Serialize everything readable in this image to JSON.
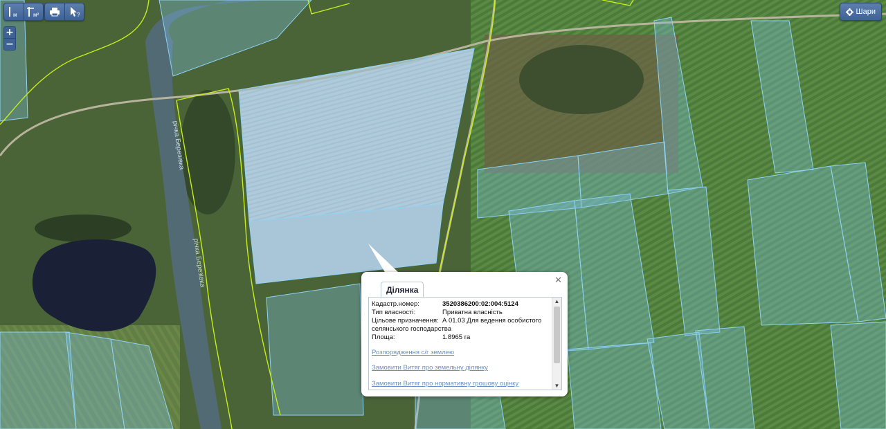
{
  "toolbar": {
    "measure_line_label": "м",
    "measure_area_label": "м²",
    "print_icon": "print-icon",
    "identify_icon": "cursor-question-icon"
  },
  "zoom": {
    "in_label": "+",
    "out_label": "−"
  },
  "layers": {
    "label": "Шари",
    "icon": "gear-icon"
  },
  "map": {
    "river_labels": [
      "річка Березівка",
      "річка Березівка"
    ],
    "colors": {
      "parcel_fill": "#7ec4e6",
      "parcel_stroke": "#8fd3f5",
      "boundary": "#c6ee1a",
      "water": "#1a2036"
    }
  },
  "popup": {
    "tab": "Ділянка",
    "close_icon": "close-icon",
    "fields": {
      "cadastral_label": "Кадастр.номер:",
      "cadastral_value": "3520386200:02:004:5124",
      "ownership_label": "Тип власності:",
      "ownership_value": "Приватна власність",
      "purpose_label": "Цільове призначення:",
      "purpose_value": "А 01.03 Для ведення особистого",
      "purpose_value_cont": "селянського господарства",
      "area_label": "Площа:",
      "area_value": "1.8965 га"
    },
    "links": [
      "Розпорядження с/г землею",
      "Замовити Витяг про земельну ділянку",
      "Замовити Витяг про нормативну грошову оцінку"
    ]
  }
}
